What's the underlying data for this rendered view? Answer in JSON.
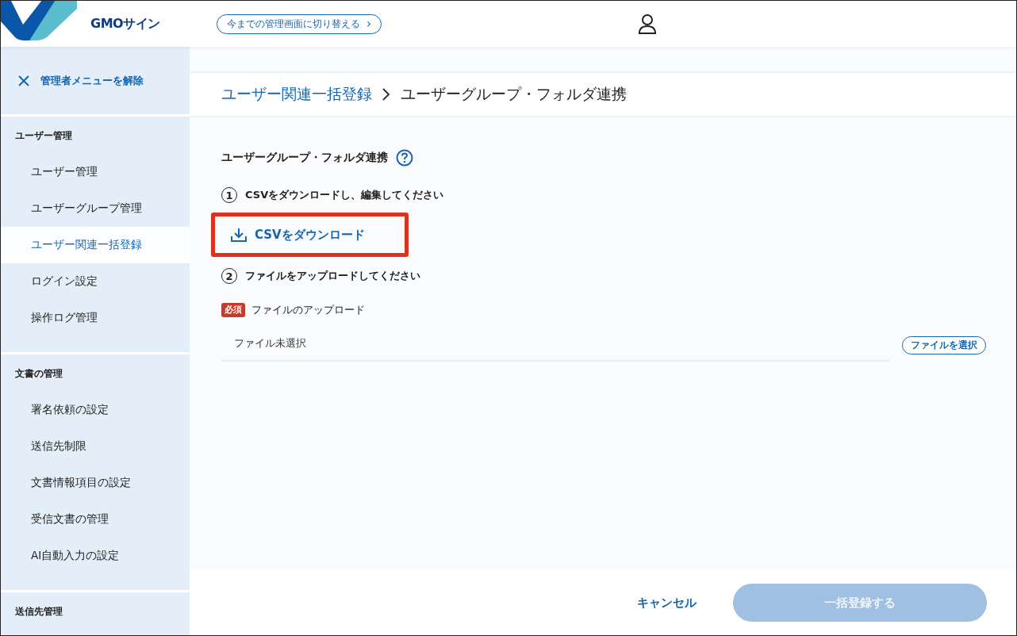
{
  "header": {
    "logo_text": "GMOサイン",
    "switch_button": "今までの管理画面に切り替える",
    "switch_chevron": "›"
  },
  "sidebar": {
    "close_label": "管理者メニューを解除",
    "groups": [
      {
        "title": "ユーザー管理",
        "items": [
          {
            "label": "ユーザー管理",
            "selected": false
          },
          {
            "label": "ユーザーグループ管理",
            "selected": false
          },
          {
            "label": "ユーザー関連一括登録",
            "selected": true
          },
          {
            "label": "ログイン設定",
            "selected": false
          },
          {
            "label": "操作ログ管理",
            "selected": false
          }
        ]
      },
      {
        "title": "文書の管理",
        "items": [
          {
            "label": "署名依頼の設定",
            "selected": false
          },
          {
            "label": "送信先制限",
            "selected": false
          },
          {
            "label": "文書情報項目の設定",
            "selected": false
          },
          {
            "label": "受信文書の管理",
            "selected": false
          },
          {
            "label": "AI自動入力の設定",
            "selected": false
          }
        ]
      },
      {
        "title": "送信先管理"
      }
    ]
  },
  "breadcrumb": [
    {
      "label": "ユーザー関連一括登録",
      "link": true
    },
    {
      "label": "ユーザーグループ・フォルダ連携",
      "link": false
    }
  ],
  "section_title": "ユーザーグループ・フォルダ連携",
  "steps": [
    {
      "number": "1",
      "text": "CSVをダウンロードし、編集してください"
    },
    {
      "number": "2",
      "text": "ファイルをアップロードしてください"
    }
  ],
  "download_link": {
    "label": "CSVをダウンロード",
    "highlighted": true
  },
  "upload": {
    "required_badge": "必須",
    "label": "ファイルのアップロード",
    "value": "ファイル未選択",
    "button": "ファイルを選択"
  },
  "footer": {
    "cancel": "キャンセル",
    "submit": {
      "label": "一括登録する",
      "disabled": true
    }
  }
}
